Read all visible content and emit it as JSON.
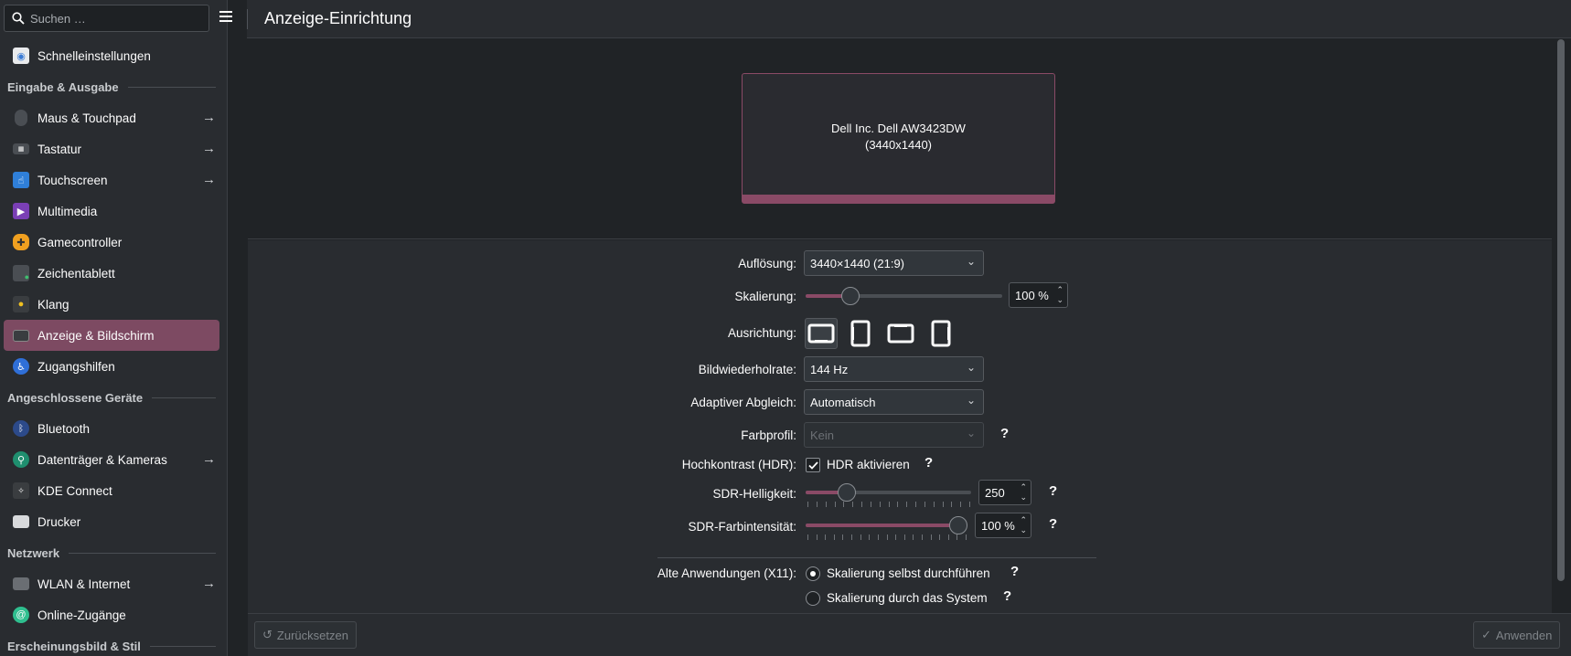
{
  "search": {
    "placeholder": "Suchen …"
  },
  "header": {
    "title": "Anzeige-Einrichtung"
  },
  "sidebar": {
    "quick": {
      "label": "Schnelleinstellungen",
      "icon": "quick-settings-icon"
    },
    "sections": [
      {
        "title": "Eingabe & Ausgabe"
      },
      {
        "title": "Angeschlossene Geräte"
      },
      {
        "title": "Netzwerk"
      },
      {
        "title": "Erscheinungsbild & Stil"
      }
    ],
    "items": [
      {
        "label": "Maus & Touchpad",
        "icon": "mouse-icon",
        "arrow": true
      },
      {
        "label": "Tastatur",
        "icon": "keyboard-icon",
        "arrow": true
      },
      {
        "label": "Touchscreen",
        "icon": "touchscreen-icon",
        "arrow": true
      },
      {
        "label": "Multimedia",
        "icon": "multimedia-icon",
        "arrow": false
      },
      {
        "label": "Gamecontroller",
        "icon": "gamepad-icon",
        "arrow": false
      },
      {
        "label": "Zeichentablett",
        "icon": "tablet-icon",
        "arrow": false
      },
      {
        "label": "Klang",
        "icon": "speaker-icon",
        "arrow": false
      },
      {
        "label": "Anzeige & Bildschirm",
        "icon": "display-icon",
        "arrow": false,
        "active": true
      },
      {
        "label": "Zugangshilfen",
        "icon": "accessibility-icon",
        "arrow": false
      },
      {
        "label": "Bluetooth",
        "icon": "bluetooth-icon",
        "arrow": false
      },
      {
        "label": "Datenträger & Kameras",
        "icon": "usb-icon",
        "arrow": true
      },
      {
        "label": "KDE Connect",
        "icon": "kde-connect-icon",
        "arrow": false
      },
      {
        "label": "Drucker",
        "icon": "printer-icon",
        "arrow": false
      },
      {
        "label": "WLAN & Internet",
        "icon": "network-icon",
        "arrow": true
      },
      {
        "label": "Online-Zugänge",
        "icon": "online-accounts-icon",
        "arrow": false
      }
    ]
  },
  "preview": {
    "monitor_name": "Dell Inc. Dell AW3423DW",
    "monitor_res": "(3440x1440)"
  },
  "settings": {
    "resolution": {
      "label": "Auflösung:",
      "value": "3440×1440 (21:9)"
    },
    "scaling": {
      "label": "Skalierung:",
      "value": "100 %",
      "level": 0.2
    },
    "orientation": {
      "label": "Ausrichtung:"
    },
    "refresh": {
      "label": "Bildwiederholrate:",
      "value": "144 Hz"
    },
    "adaptive": {
      "label": "Adaptiver Abgleich:",
      "value": "Automatisch"
    },
    "color_profile": {
      "label": "Farbprofil:",
      "value": "Kein"
    },
    "hdr": {
      "label": "Hochkontrast (HDR):",
      "checkbox": "HDR aktivieren",
      "checked": true
    },
    "sdr_brightness": {
      "label": "SDR-Helligkeit:",
      "value": "250",
      "level": 0.22
    },
    "sdr_color": {
      "label": "SDR-Farbintensität:",
      "value": "100 %",
      "level": 1.0
    },
    "legacy": {
      "label": "Alte Anwendungen (X11):",
      "option1": "Skalierung selbst durchführen",
      "option2": "Skalierung durch das System",
      "selected": 1
    },
    "help": "?"
  },
  "footer": {
    "reset": "Zurücksetzen",
    "apply": "Anwenden"
  },
  "colors": {
    "accent": "#8a4a66",
    "bg": "#202326",
    "panel": "#292c30"
  }
}
